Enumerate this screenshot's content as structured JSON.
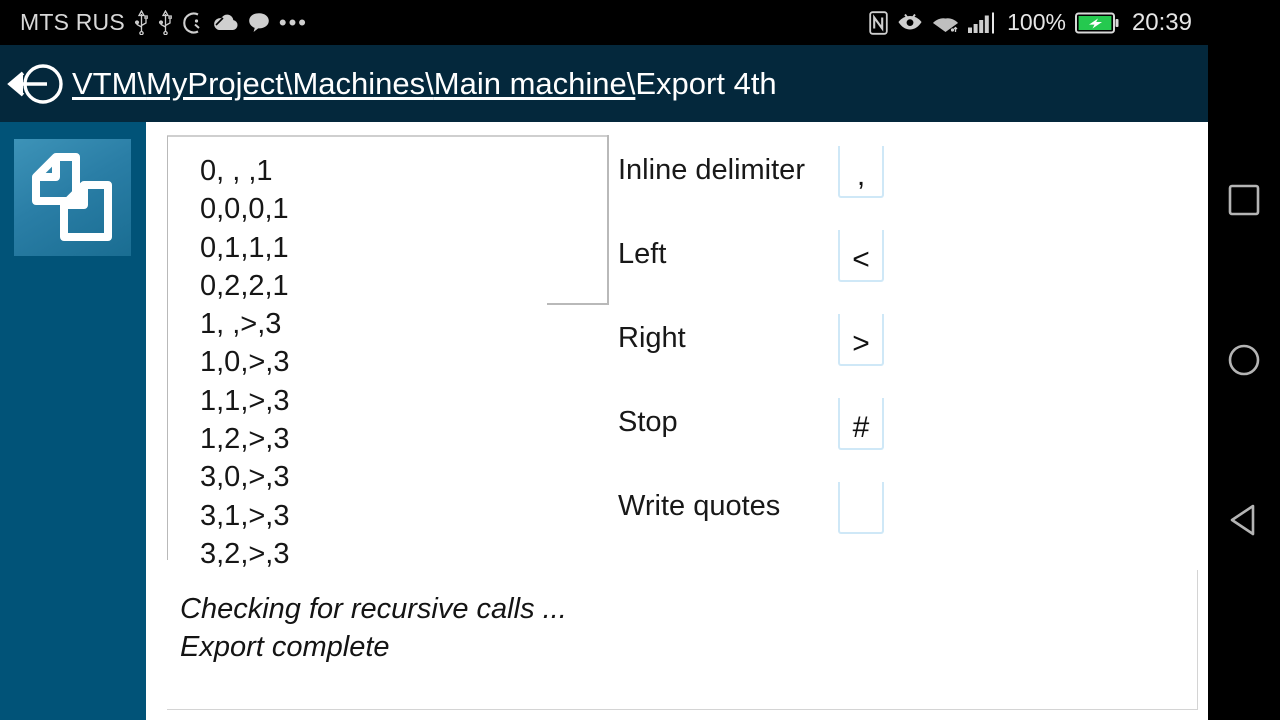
{
  "status_bar": {
    "carrier": "MTS RUS",
    "battery_percent": "100%",
    "clock": "20:39",
    "left_icons": [
      "usb-icon",
      "usb-icon",
      "alarm-icon",
      "cloud-icon",
      "message-icon",
      "more-dots-icon"
    ],
    "right_icons": [
      "nfc-icon",
      "eye-care-icon",
      "wifi-icon",
      "signal-icon",
      "battery-charging-icon"
    ]
  },
  "title_bar": {
    "back_icon": "back-arrow-icon",
    "breadcrumb": [
      {
        "label": "VTM\\",
        "is_link": true
      },
      {
        "label": "MyProject\\",
        "is_link": true
      },
      {
        "label": "Machines\\",
        "is_link": true
      },
      {
        "label": "Main machine\\",
        "is_link": true
      },
      {
        "label": "Export 4th",
        "is_link": false
      }
    ]
  },
  "sidebar": {
    "app_icon": "copy-documents-icon",
    "background_color": "#015378"
  },
  "tape": {
    "lines": [
      "0, , ,1",
      "0,0,0,1",
      "0,1,1,1",
      "0,2,2,1",
      "1, ,>,3",
      "1,0,>,3",
      "1,1,>,3",
      "1,2,>,3",
      "3,0,>,3",
      "3,1,>,3",
      "3,2,>,3"
    ]
  },
  "form": {
    "fields": [
      {
        "label": "Inline delimiter",
        "value": ",",
        "placeholder": ""
      },
      {
        "label": "Left",
        "value": "<",
        "placeholder": ""
      },
      {
        "label": "Right",
        "value": ">",
        "placeholder": ""
      },
      {
        "label": "Stop",
        "value": "#",
        "placeholder": ""
      },
      {
        "label": "Write quotes",
        "value": "",
        "placeholder": ""
      }
    ]
  },
  "log": {
    "lines": [
      "Checking for recursive calls ...",
      "Export complete"
    ]
  },
  "nav_bar": {
    "buttons": [
      "recents-square-icon",
      "home-circle-icon",
      "back-triangle-icon"
    ]
  },
  "colors": {
    "title_bar": "#04283c",
    "sidebar": "#015378",
    "input_underline": "#cfe8f7",
    "content_bg": "#ffffff"
  }
}
